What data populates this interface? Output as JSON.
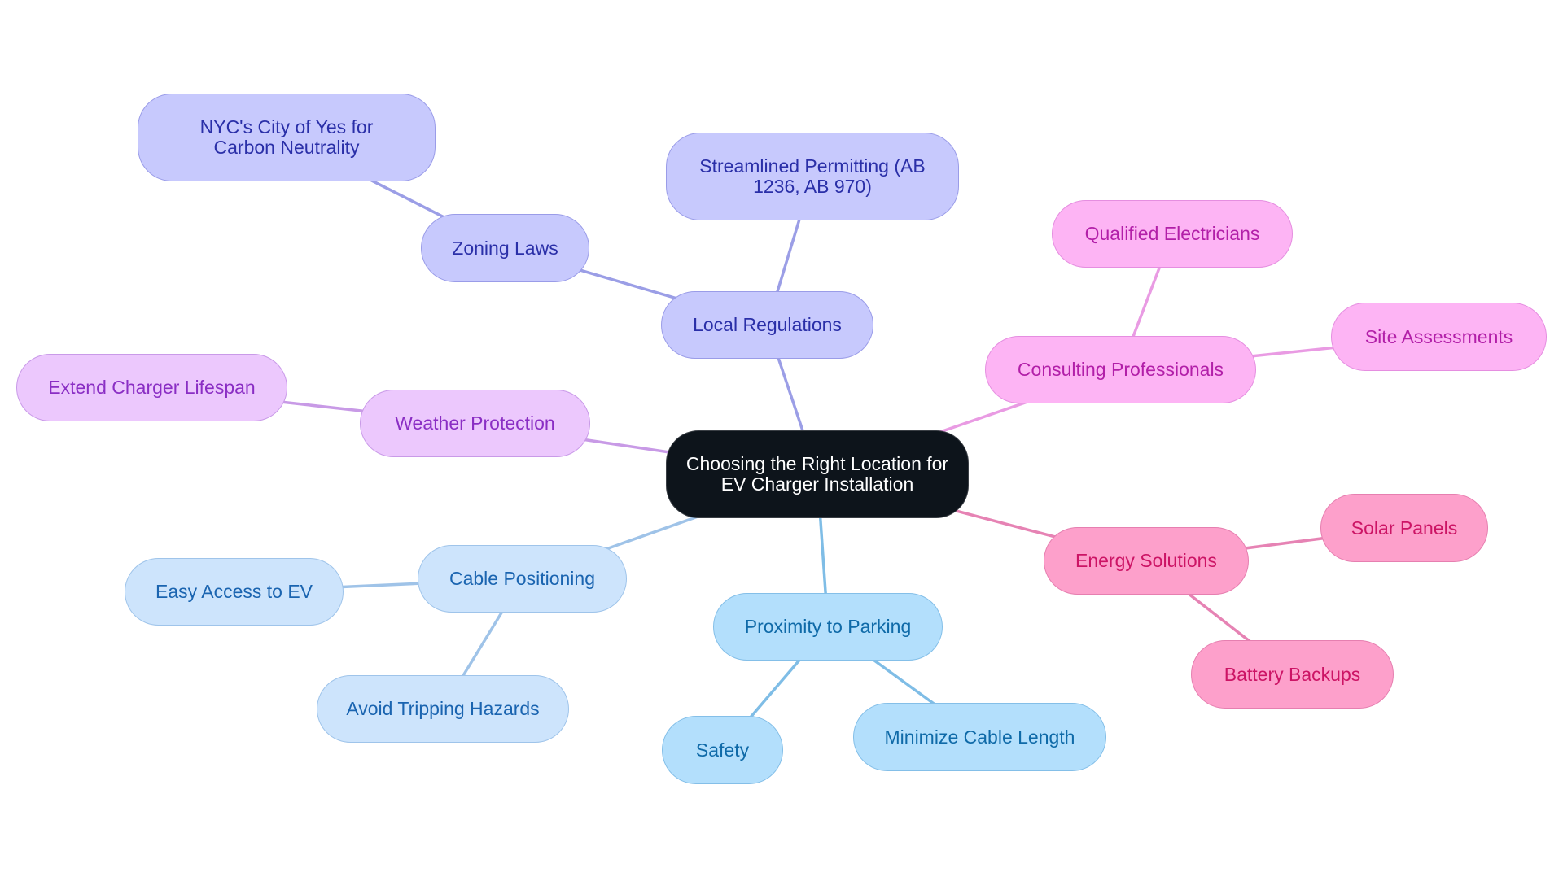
{
  "diagram": {
    "type": "mindmap",
    "root": {
      "id": "root",
      "label": "Choosing the Right Location for EV Charger Installation"
    },
    "colors": {
      "regulations": "#9b9ee6",
      "consulting": "#e99be3",
      "weather": "#c89ae6",
      "energy": "#e683b4",
      "cable": "#9fc3e8",
      "proximity": "#7fbde6"
    },
    "nodes": [
      {
        "id": "local-regulations",
        "label": "Local Regulations",
        "parent": "root",
        "group": "regulations"
      },
      {
        "id": "zoning-laws",
        "label": "Zoning Laws",
        "parent": "local-regulations",
        "group": "regulations"
      },
      {
        "id": "nyc-city-of-yes",
        "label": "NYC's City of Yes for Carbon Neutrality",
        "parent": "zoning-laws",
        "group": "regulations"
      },
      {
        "id": "streamlined-permitting",
        "label": "Streamlined Permitting (AB 1236, AB 970)",
        "parent": "local-regulations",
        "group": "regulations"
      },
      {
        "id": "consulting-professionals",
        "label": "Consulting Professionals",
        "parent": "root",
        "group": "consulting"
      },
      {
        "id": "qualified-electricians",
        "label": "Qualified Electricians",
        "parent": "consulting-professionals",
        "group": "consulting"
      },
      {
        "id": "site-assessments",
        "label": "Site Assessments",
        "parent": "consulting-professionals",
        "group": "consulting"
      },
      {
        "id": "weather-protection",
        "label": "Weather Protection",
        "parent": "root",
        "group": "weather"
      },
      {
        "id": "extend-charger-lifespan",
        "label": "Extend Charger Lifespan",
        "parent": "weather-protection",
        "group": "weather"
      },
      {
        "id": "energy-solutions",
        "label": "Energy Solutions",
        "parent": "root",
        "group": "energy"
      },
      {
        "id": "solar-panels",
        "label": "Solar Panels",
        "parent": "energy-solutions",
        "group": "energy"
      },
      {
        "id": "battery-backups",
        "label": "Battery Backups",
        "parent": "energy-solutions",
        "group": "energy"
      },
      {
        "id": "cable-positioning",
        "label": "Cable Positioning",
        "parent": "root",
        "group": "cable"
      },
      {
        "id": "easy-access-to-ev",
        "label": "Easy Access to EV",
        "parent": "cable-positioning",
        "group": "cable"
      },
      {
        "id": "avoid-tripping-hazards",
        "label": "Avoid Tripping Hazards",
        "parent": "cable-positioning",
        "group": "cable"
      },
      {
        "id": "proximity-to-parking",
        "label": "Proximity to Parking",
        "parent": "root",
        "group": "proximity"
      },
      {
        "id": "safety",
        "label": "Safety",
        "parent": "proximity-to-parking",
        "group": "proximity"
      },
      {
        "id": "minimize-cable-length",
        "label": "Minimize Cable Length",
        "parent": "proximity-to-parking",
        "group": "proximity"
      }
    ]
  }
}
